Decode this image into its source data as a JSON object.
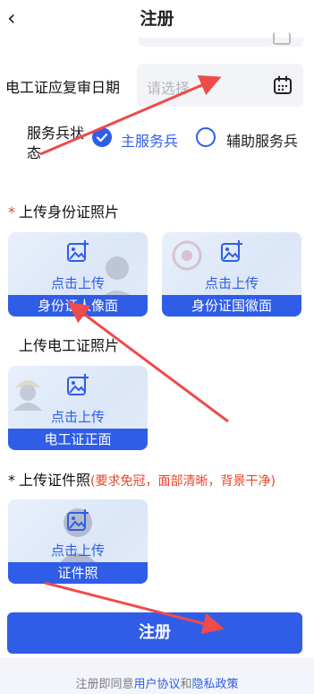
{
  "header": {
    "title": "注册",
    "back_icon": "‹"
  },
  "form": {
    "review_date": {
      "label": "电工证应复审日期",
      "placeholder": "请选择"
    },
    "service_status": {
      "label_line1": "服务兵状",
      "label_line2": "态",
      "options": [
        "主服务兵",
        "辅助服务兵"
      ],
      "selected": "主服务兵"
    }
  },
  "id_section": {
    "required_mark": "*",
    "title": "上传身份证照片",
    "cards": [
      {
        "upload": "点击上传",
        "caption": "身份证人像面"
      },
      {
        "upload": "点击上传",
        "caption": "身份证国徽面"
      }
    ]
  },
  "elec_section": {
    "title": "上传电工证照片",
    "card": {
      "upload": "点击上传",
      "caption": "电工证正面"
    }
  },
  "photo_section": {
    "required_mark": "*",
    "title": "上传证件照",
    "hint": "(要求免冠，面部清晰，背景干净)",
    "card": {
      "upload": "点击上传",
      "caption": "证件照"
    }
  },
  "register_button": "注册",
  "agreement": {
    "prefix": "注册即同意",
    "terms": "用户协议",
    "and": "和",
    "privacy": "隐私政策"
  },
  "colors": {
    "accent": "#2f5de8",
    "required": "#e8442a",
    "annotation_arrow": "#ee4b4b"
  }
}
